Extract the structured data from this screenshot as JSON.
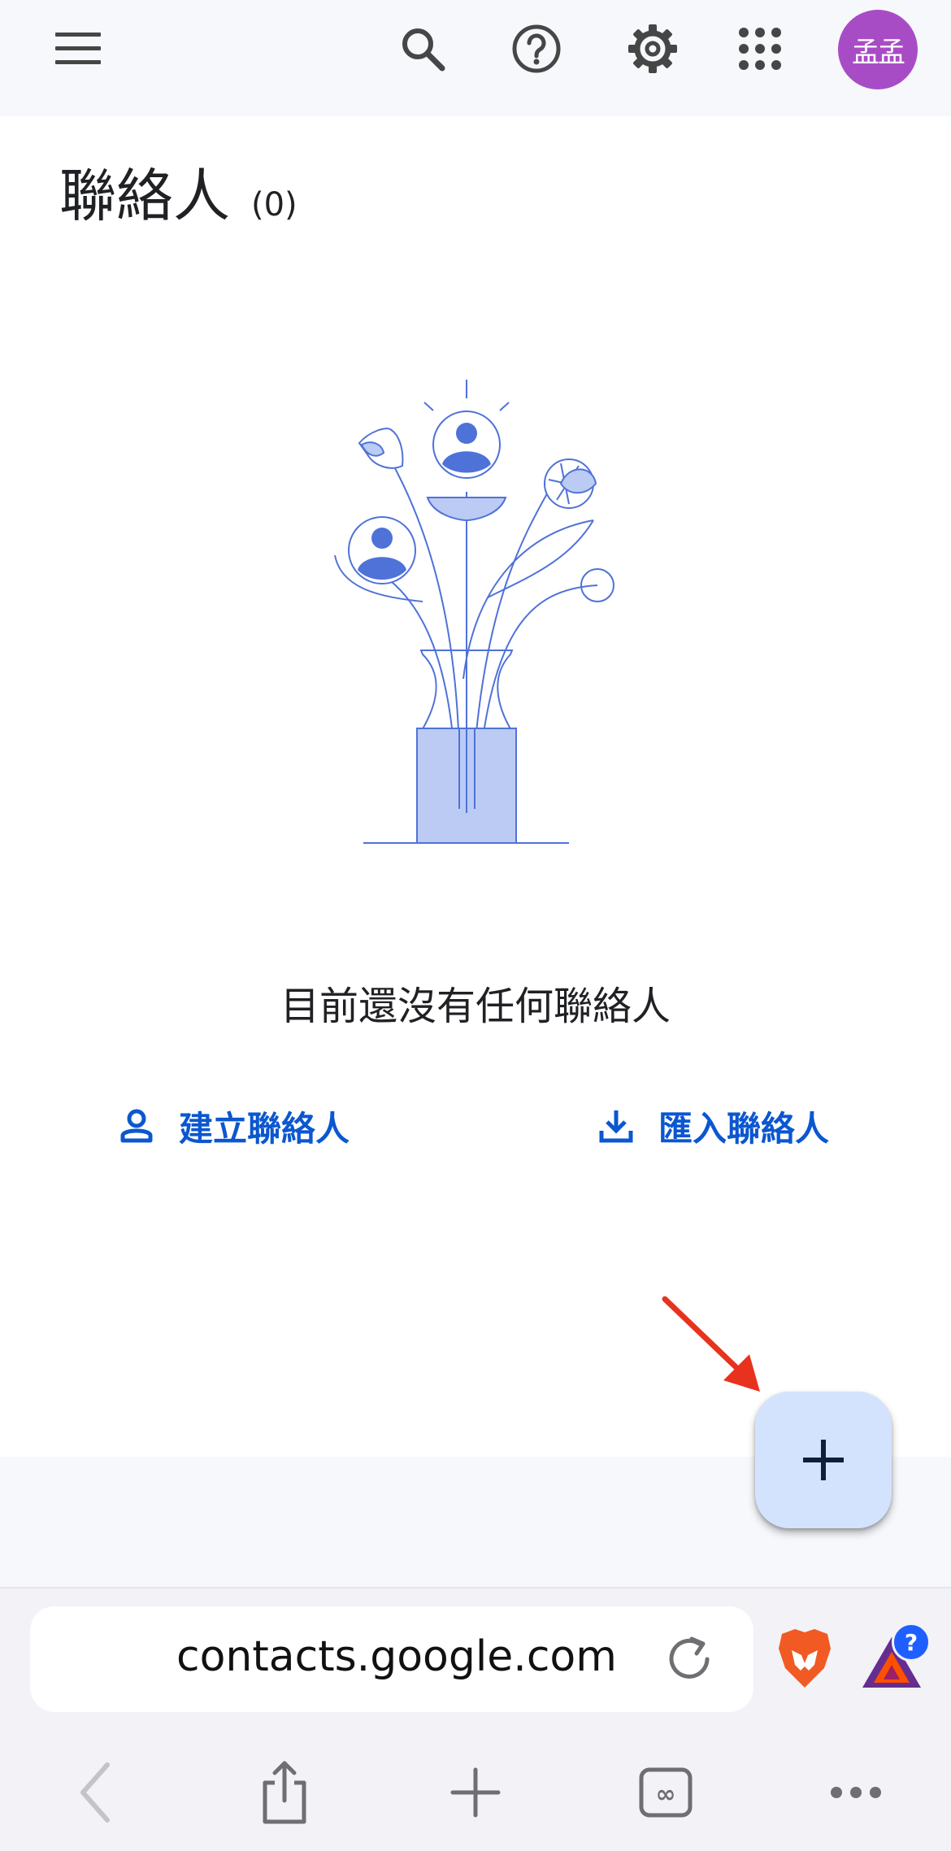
{
  "header": {
    "menu_icon": "menu-icon",
    "search_icon": "search-icon",
    "help_icon": "help-icon",
    "settings_icon": "settings-icon",
    "apps_icon": "apps-icon",
    "avatar_initials": "孟孟",
    "avatar_color": "#a84cc6"
  },
  "page": {
    "title": "聯絡人",
    "count": "(0)",
    "empty_message": "目前還沒有任何聯絡人"
  },
  "actions": {
    "create_label": "建立聯絡人",
    "create_icon": "person-icon",
    "import_label": "匯入聯絡人",
    "import_icon": "download-icon"
  },
  "fab": {
    "icon": "plus-icon",
    "color": "#d3e3fd"
  },
  "annotation": {
    "arrow_color": "#e8321e"
  },
  "browser": {
    "url": "contacts.google.com",
    "reload_icon": "reload-icon",
    "brave_icon": "brave-lion-icon",
    "bat_icon": "bat-triangle-icon",
    "bat_badge": "?",
    "back_icon": "back-icon",
    "share_icon": "share-icon",
    "new_tab_icon": "plus-icon",
    "tabs_icon": "tabs-icon",
    "more_icon": "more-icon"
  },
  "colors": {
    "accent_blue": "#0b57d0",
    "illustration_blue": "#4f72d8"
  }
}
